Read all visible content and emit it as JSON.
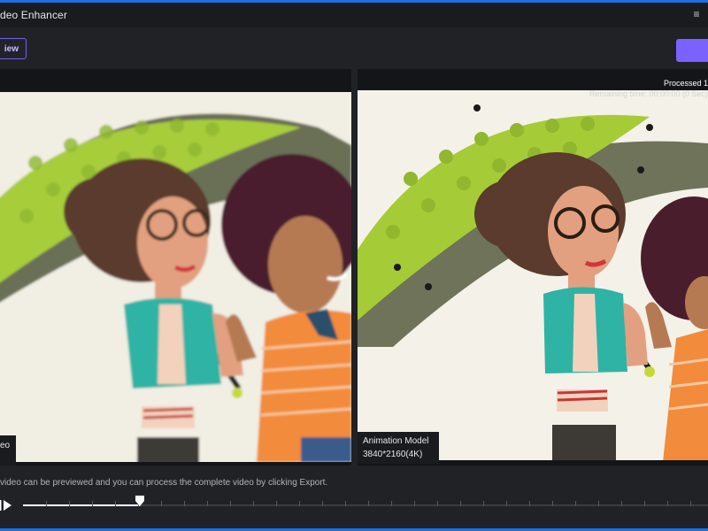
{
  "app": {
    "title": "deo Enhancer"
  },
  "toolbar": {
    "preview_label": "iew"
  },
  "left_panel": {
    "label": "eo"
  },
  "right_panel": {
    "processed_text": "Processed 1",
    "remaining_text": "Remaining time: 00:00:00 (0 Sec)",
    "model_label": "Animation Model",
    "resolution_label": "3840*2160(4K)"
  },
  "footer": {
    "hint": "video can be previewed and you can process the complete video by clicking Export.",
    "progress": 0.17
  },
  "colors": {
    "accent": "#7b61ff",
    "brand_blue": "#1f6fe0"
  }
}
